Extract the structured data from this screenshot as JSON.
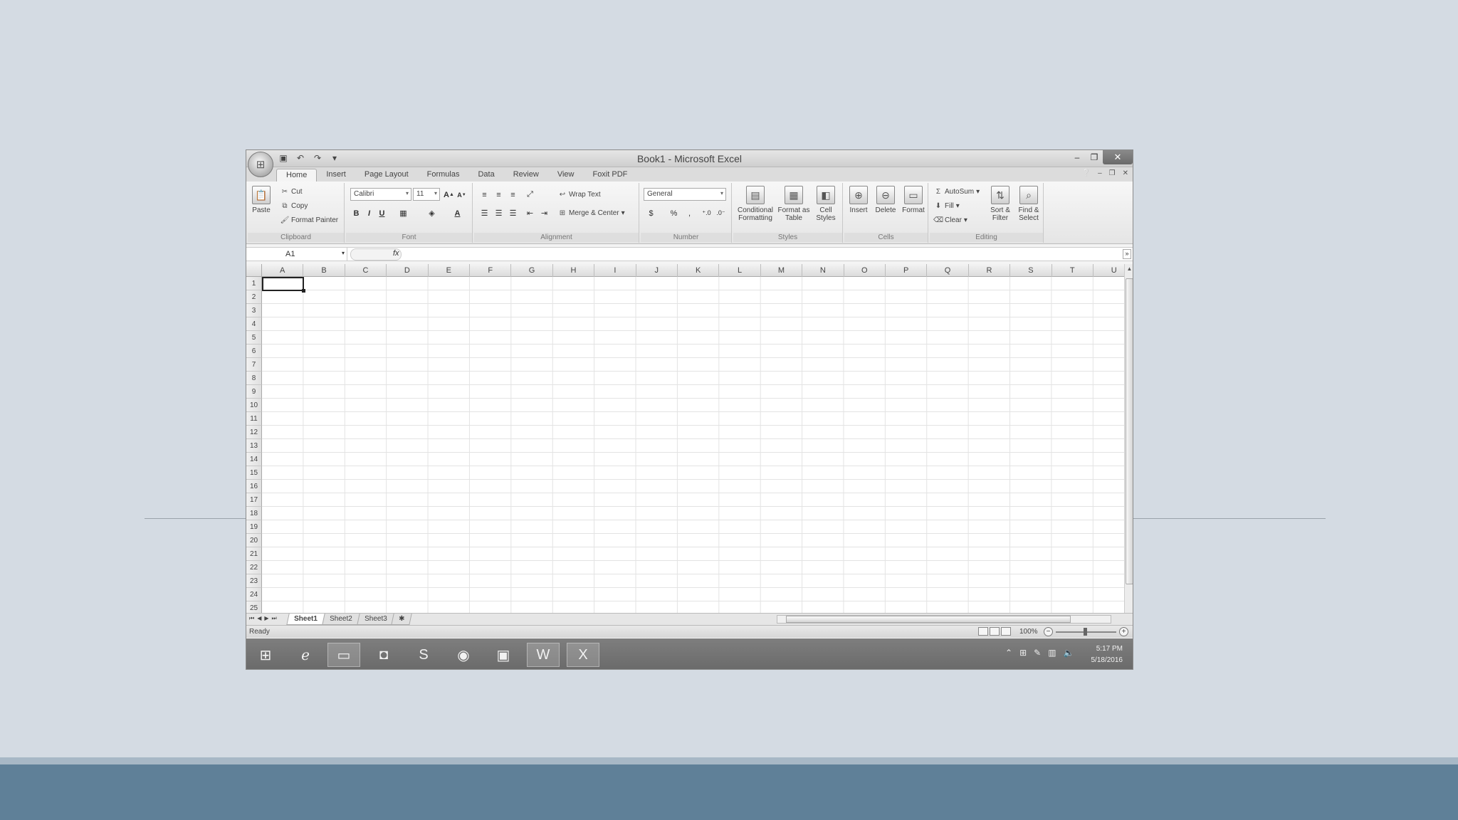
{
  "window": {
    "title": "Book1 - Microsoft Excel",
    "controls": [
      "minimize-icon",
      "restore-icon",
      "close-icon"
    ]
  },
  "quick_access": [
    "save-icon",
    "undo-icon",
    "redo-icon",
    "qat-dropdown-icon"
  ],
  "ribbon_tabs": [
    "Home",
    "Insert",
    "Page Layout",
    "Formulas",
    "Data",
    "Review",
    "View",
    "Foxit PDF"
  ],
  "active_tab": "Home",
  "ribbon": {
    "clipboard": {
      "label": "Clipboard",
      "paste": "Paste",
      "cut": "Cut",
      "copy": "Copy",
      "format_painter": "Format Painter"
    },
    "font": {
      "label": "Font",
      "family": "Calibri",
      "size": "11"
    },
    "alignment": {
      "label": "Alignment",
      "wrap_text": "Wrap Text",
      "merge_center": "Merge & Center"
    },
    "number": {
      "label": "Number",
      "format": "General",
      "percent": "%"
    },
    "styles": {
      "label": "Styles",
      "conditional": "Conditional Formatting",
      "format_table": "Format as Table",
      "cell_styles": "Cell Styles"
    },
    "cells": {
      "label": "Cells",
      "insert": "Insert",
      "delete": "Delete",
      "format": "Format"
    },
    "editing": {
      "label": "Editing",
      "autosum": "AutoSum",
      "fill": "Fill",
      "clear": "Clear",
      "sort_filter": "Sort & Filter",
      "find_select": "Find & Select"
    }
  },
  "formula_bar": {
    "name_box": "A1",
    "fx": "fx",
    "value": ""
  },
  "columns": [
    "A",
    "B",
    "C",
    "D",
    "E",
    "F",
    "G",
    "H",
    "I",
    "J",
    "K",
    "L",
    "M",
    "N",
    "O",
    "P",
    "Q",
    "R",
    "S",
    "T",
    "U"
  ],
  "rows": [
    "1",
    "2",
    "3",
    "4",
    "5",
    "6",
    "7",
    "8",
    "9",
    "10",
    "11",
    "12",
    "13",
    "14",
    "15",
    "16",
    "17",
    "18",
    "19",
    "20",
    "21",
    "22",
    "23",
    "24",
    "25"
  ],
  "selected_cell": "A1",
  "sheets": [
    "Sheet1",
    "Sheet2",
    "Sheet3"
  ],
  "active_sheet": "Sheet1",
  "status": {
    "text": "Ready",
    "zoom": "100%"
  },
  "taskbar": {
    "apps": [
      "windows-start-icon",
      "internet-explorer-icon",
      "file-explorer-icon",
      "store-icon",
      "skype-icon",
      "chrome-icon",
      "photos-icon",
      "word-icon",
      "excel-icon"
    ],
    "time": "5:17 PM",
    "date": "5/18/2016"
  }
}
